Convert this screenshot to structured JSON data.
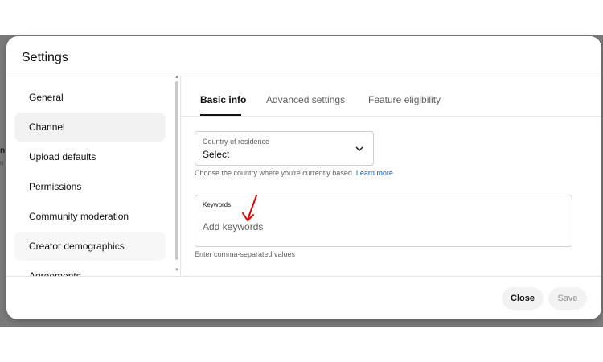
{
  "backdrop": {
    "peek_text_1": "n",
    "peek_text_2": "n"
  },
  "dialog": {
    "title": "Settings"
  },
  "sidebar": {
    "items": [
      {
        "label": "General"
      },
      {
        "label": "Channel"
      },
      {
        "label": "Upload defaults"
      },
      {
        "label": "Permissions"
      },
      {
        "label": "Community moderation"
      },
      {
        "label": "Creator demographics"
      },
      {
        "label": "Agreements"
      }
    ],
    "active_index": 1
  },
  "tabs": [
    {
      "label": "Basic info",
      "active": true
    },
    {
      "label": "Advanced settings",
      "active": false
    },
    {
      "label": "Feature eligibility",
      "active": false
    }
  ],
  "country": {
    "label": "Country of residence",
    "value": "Select",
    "help": "Choose the country where you're currently based.",
    "help_link": "Learn more"
  },
  "keywords": {
    "label": "Keywords",
    "placeholder": "Add keywords",
    "help": "Enter comma-separated values"
  },
  "footer": {
    "close_label": "Close",
    "save_label": "Save"
  },
  "colors": {
    "link": "#065fd4",
    "annotation_arrow": "#e00000"
  },
  "icons": {
    "select_chevron": "chevron-down-icon",
    "annotation": "red-arrow-icon"
  }
}
